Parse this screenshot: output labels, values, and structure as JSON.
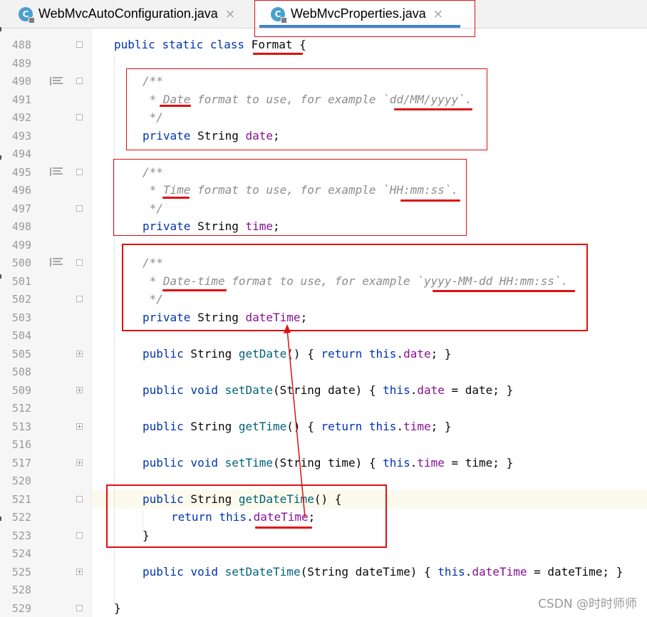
{
  "tabs": [
    {
      "label": "WebMvcAutoConfiguration.java",
      "icon": "C",
      "active": false
    },
    {
      "label": "WebMvcProperties.java",
      "icon": "C",
      "active": true
    }
  ],
  "close_glyph": "×",
  "lines": [
    {
      "no": "488",
      "text": "public static class Format {"
    },
    {
      "no": "489",
      "text": ""
    },
    {
      "no": "490",
      "text": "/**"
    },
    {
      "no": "491",
      "text": " * Date format to use, for example `dd/MM/yyyy`."
    },
    {
      "no": "492",
      "text": " */"
    },
    {
      "no": "493",
      "text": "private String date;"
    },
    {
      "no": "494",
      "text": ""
    },
    {
      "no": "495",
      "text": "/**"
    },
    {
      "no": "496",
      "text": " * Time format to use, for example `HH:mm:ss`."
    },
    {
      "no": "497",
      "text": " */"
    },
    {
      "no": "498",
      "text": "private String time;"
    },
    {
      "no": "499",
      "text": ""
    },
    {
      "no": "500",
      "text": "/**"
    },
    {
      "no": "501",
      "text": " * Date-time format to use, for example `yyyy-MM-dd HH:mm:ss`."
    },
    {
      "no": "502",
      "text": " */"
    },
    {
      "no": "503",
      "text": "private String dateTime;"
    },
    {
      "no": "504",
      "text": ""
    },
    {
      "no": "505",
      "text": "public String getDate() { return this.date; }"
    },
    {
      "no": "508",
      "text": ""
    },
    {
      "no": "509",
      "text": "public void setDate(String date) { this.date = date; }"
    },
    {
      "no": "512",
      "text": ""
    },
    {
      "no": "513",
      "text": "public String getTime() { return this.time; }"
    },
    {
      "no": "516",
      "text": ""
    },
    {
      "no": "517",
      "text": "public void setTime(String time) { this.time = time; }"
    },
    {
      "no": "520",
      "text": ""
    },
    {
      "no": "521",
      "text": "public String getDateTime() {"
    },
    {
      "no": "522",
      "text": "return this.dateTime;"
    },
    {
      "no": "523",
      "text": "}"
    },
    {
      "no": "524",
      "text": ""
    },
    {
      "no": "525",
      "text": "public void setDateTime(String dateTime) { this.dateTime = dateTime; }"
    },
    {
      "no": "528",
      "text": ""
    },
    {
      "no": "529",
      "text": "}"
    }
  ],
  "watermark": "CSDN @时时师师",
  "colors": {
    "keyword": "#0033b3",
    "field": "#871094",
    "method": "#00627a",
    "comment": "#8c8c8c",
    "annotation_red": "#e01010",
    "tab_underline": "#4083c9"
  },
  "icons": [
    "class-icon",
    "close-icon",
    "fold-marker-icon",
    "doc-comment-icon"
  ]
}
